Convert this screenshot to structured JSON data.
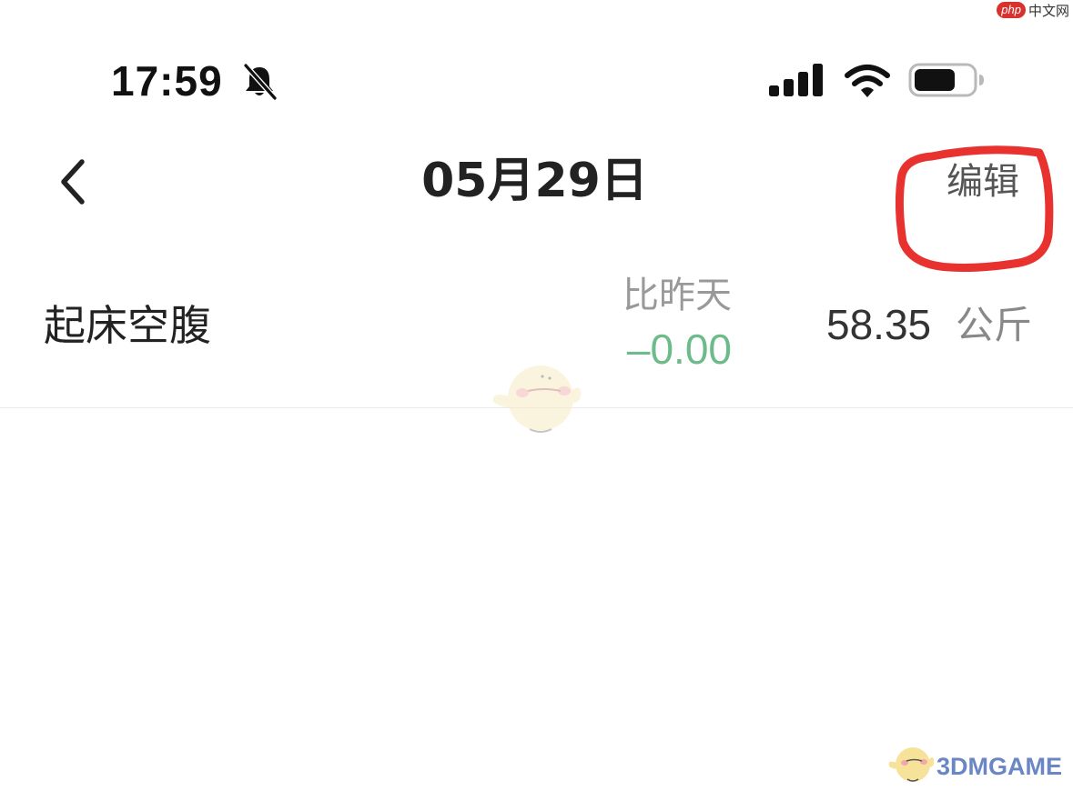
{
  "watermark_top": {
    "brand": "php",
    "site": "中文网"
  },
  "status_bar": {
    "time": "17:59",
    "icons": [
      "bell-slash-icon",
      "cellular-signal-icon",
      "wifi-icon",
      "battery-icon"
    ]
  },
  "nav": {
    "back_icon": "chevron-left-icon",
    "title": "05月29日",
    "edit_label": "编辑",
    "highlight_color": "#e8322f"
  },
  "record": {
    "label": "起床空腹",
    "compare_label": "比昨天",
    "compare_value": "–0.00",
    "weight_value": "58.35",
    "weight_unit": "公斤",
    "compare_color": "#6dbb8a"
  },
  "watermark_bottom": {
    "text": "3DMGAME"
  }
}
